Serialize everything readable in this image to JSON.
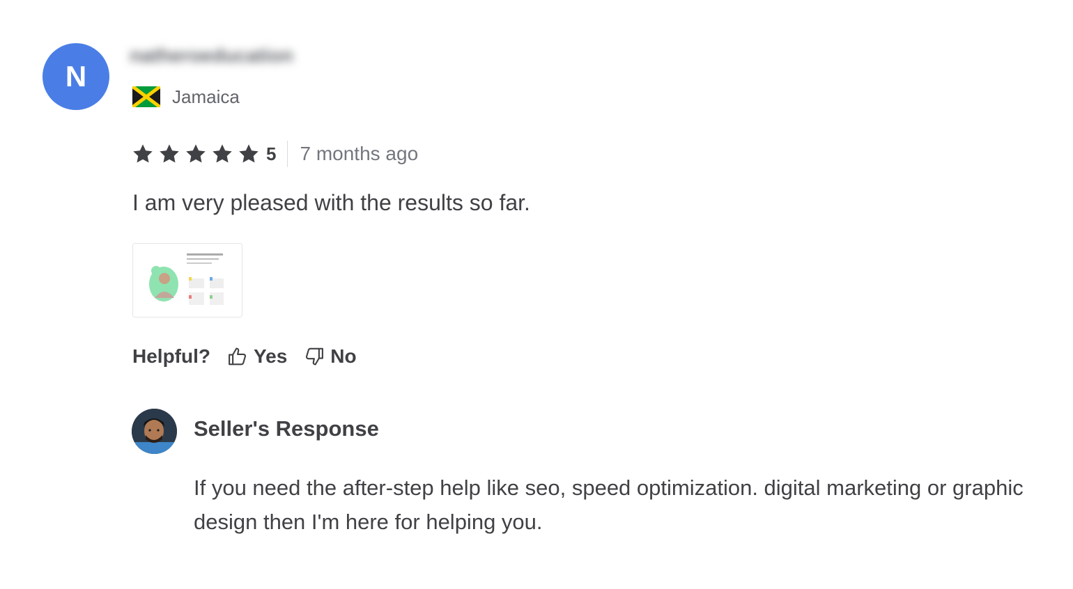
{
  "reviewer": {
    "avatar_initial": "N",
    "username": "natheroeducation",
    "country": "Jamaica",
    "flag_icon": "jamaica-flag-icon"
  },
  "rating": {
    "stars": 5,
    "value_label": "5",
    "time_ago": "7 months ago",
    "star_color": "#404145"
  },
  "review": {
    "text": "I am very pleased with the results so far."
  },
  "helpful": {
    "label": "Helpful?",
    "yes_label": "Yes",
    "no_label": "No",
    "yes_icon": "thumbs-up-icon",
    "no_icon": "thumbs-down-icon"
  },
  "seller_response": {
    "title": "Seller's Response",
    "text": "If you need the after-step help like seo, speed optimization. digital marketing or graphic design then I'm here for helping you."
  },
  "colors": {
    "avatar_bg": "#4a7ee6",
    "text_primary": "#404145",
    "text_secondary": "#74767e"
  }
}
